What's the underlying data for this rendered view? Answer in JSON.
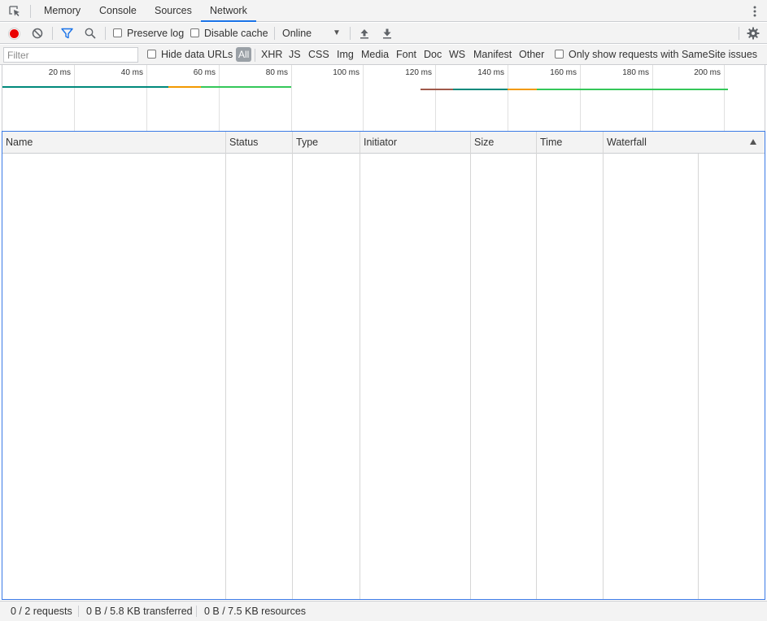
{
  "tabs": [
    {
      "label": "Memory",
      "selected": false
    },
    {
      "label": "Console",
      "selected": false
    },
    {
      "label": "Sources",
      "selected": false
    },
    {
      "label": "Network",
      "selected": true
    }
  ],
  "toolbar": {
    "preserve_log": "Preserve log",
    "disable_cache": "Disable cache",
    "throttling": "Online",
    "recording": true
  },
  "filterbar": {
    "placeholder": "Filter",
    "hide_data_urls": "Hide data URLs",
    "types": [
      "All",
      "XHR",
      "JS",
      "CSS",
      "Img",
      "Media",
      "Font",
      "Doc",
      "WS",
      "Manifest",
      "Other"
    ],
    "selected_type": "All",
    "samesite": "Only show requests with SameSite issues"
  },
  "overview": {
    "ticks": [
      "20 ms",
      "40 ms",
      "60 ms",
      "80 ms",
      "100 ms",
      "120 ms",
      "140 ms",
      "160 ms",
      "180 ms",
      "200 ms"
    ]
  },
  "table": {
    "columns": [
      "Name",
      "Status",
      "Type",
      "Initiator",
      "Size",
      "Time",
      "Waterfall"
    ]
  },
  "status": {
    "requests": "0 / 2 requests",
    "transferred": "0 B / 5.8 KB transferred",
    "resources": "0 B / 7.5 KB resources"
  },
  "colors": {
    "accent": "#1a73e8",
    "record": "#ea0000",
    "bar_teal": "#00897b",
    "bar_orange": "#f29900",
    "bar_green": "#34c759",
    "bar_red": "#a0594a"
  }
}
